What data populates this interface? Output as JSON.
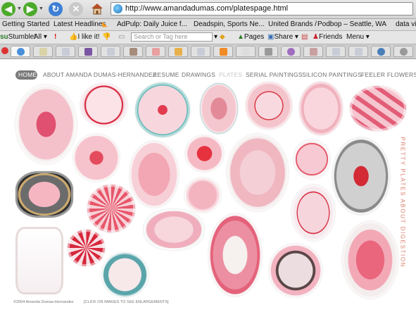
{
  "browser": {
    "url": "http://www.amandadumas.com/platespage.html",
    "bookmarks": [
      "Getting Started",
      "Latest Headlines",
      "AdPulp: Daily Juice f...",
      "Deadspin, Sports Ne...",
      "United Brands /",
      "Podbop – Seattle, WA",
      "data vis"
    ],
    "stumble_toolbar": {
      "brand": "Stumble!",
      "all": "All",
      "like": "I like it!",
      "search_placeholder": "Search or Tag here",
      "pages": "Pages",
      "share": "Share",
      "friends": "Friends",
      "menu": "Menu"
    }
  },
  "page": {
    "nav": [
      "HOME",
      "ABOUT AMANDA DUMAS-HERNANDEZ",
      "RESUME",
      "DRAWINGS",
      "PLATES",
      "SERIAL PAINTINGS",
      "SILICON PAINTINGS",
      "FEELER FLOWERS"
    ],
    "side_title": "PRETTY PLATES ABOUT DIGESTION",
    "copyright": "©2004 Amanda Dumas-Hernandez",
    "hint": "[CLICK ON IMAGES TO SEE ENLARGEMENTS]"
  },
  "colors": {
    "accent": "#d87c6a",
    "plate_red": "#cf2a3a",
    "plate_pink": "#f0a6b4",
    "nav_gray": "#6f6f6f"
  }
}
